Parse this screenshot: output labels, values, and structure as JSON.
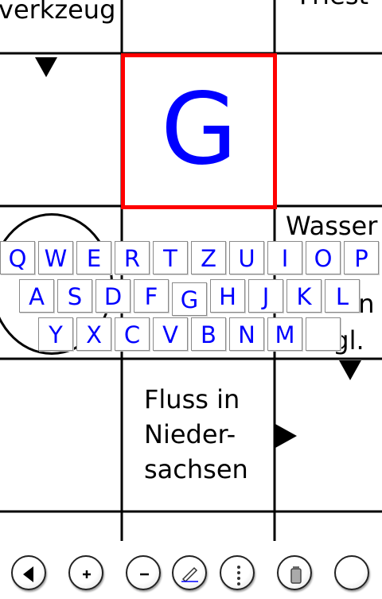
{
  "puzzle": {
    "clues": {
      "top_left": "verkzeug",
      "top_right": "Friest",
      "mid_right_1": "Wasser",
      "mid_right_2": "hn",
      "mid_right_3": "ngl.",
      "lower_center_1": "Fluss in",
      "lower_center_2": "Nieder-",
      "lower_center_3": "sachsen"
    },
    "selected_cell": {
      "letter": "G",
      "highlight_color": "#ff0000",
      "letter_color": "#0000ff"
    }
  },
  "keyboard": {
    "rows": [
      [
        "Q",
        "W",
        "E",
        "R",
        "T",
        "Z",
        "U",
        "I",
        "O",
        "P"
      ],
      [
        "A",
        "S",
        "D",
        "F",
        "G",
        "H",
        "J",
        "K",
        "L"
      ],
      [
        "Y",
        "X",
        "C",
        "V",
        "B",
        "N",
        "M",
        ""
      ]
    ],
    "key_color": "#0000ff"
  },
  "toolbar": {
    "buttons": [
      "back-icon",
      "zoom-in-icon",
      "zoom-out-icon",
      "pencil-icon",
      "vertical-dots-icon",
      "trash-icon",
      "blank-circle-icon"
    ]
  }
}
